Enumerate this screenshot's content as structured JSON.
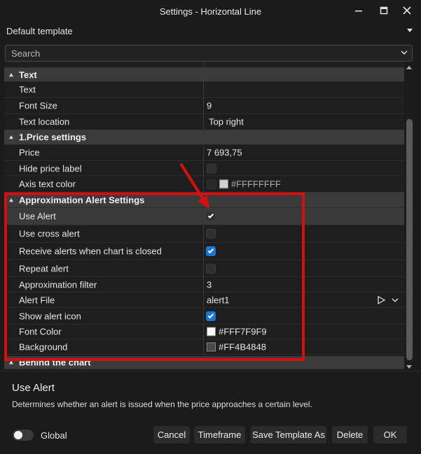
{
  "window": {
    "title": "Settings - Horizontal Line",
    "minimize_icon": "minimize-icon",
    "maximize_icon": "maximize-icon",
    "close_icon": "close-icon"
  },
  "template": {
    "selected": "Default template"
  },
  "search": {
    "placeholder": "Search"
  },
  "sections": {
    "text": {
      "label": "Text",
      "rows": [
        {
          "name": "Text",
          "value": ""
        },
        {
          "name": "Font Size",
          "value": "9"
        },
        {
          "name": "Text location",
          "value": "Top right"
        }
      ]
    },
    "price": {
      "label": "1.Price settings",
      "price": {
        "name": "Price",
        "value": "7 693,75"
      },
      "hide_label": {
        "name": "Hide price label",
        "checked": false
      },
      "axis_color": {
        "name": "Axis text color",
        "value": "#FFFFFFFF",
        "color": "#d0d0d0"
      }
    },
    "alert": {
      "label": "Approximation Alert Settings",
      "use_alert": {
        "name": "Use Alert",
        "checked": true
      },
      "use_cross": {
        "name": "Use cross alert",
        "checked": false
      },
      "receive_closed": {
        "name": "Receive alerts when chart is closed",
        "checked": true
      },
      "repeat": {
        "name": "Repeat alert",
        "checked": false
      },
      "filter": {
        "name": "Approximation filter",
        "value": "3"
      },
      "file": {
        "name": "Alert File",
        "value": "alert1"
      },
      "show_icon": {
        "name": "Show alert icon",
        "checked": true
      },
      "font_color": {
        "name": "Font Color",
        "value": "#FFF7F9F9",
        "color": "#f7f9f9"
      },
      "background": {
        "name": "Background",
        "value": "#FF4B4848",
        "color": "#4b4848"
      }
    },
    "behind": {
      "label": "Behind the chart"
    }
  },
  "description": {
    "title": "Use Alert",
    "text": "Determines whether an alert is issued when the price approaches a certain level."
  },
  "footer": {
    "global_label": "Global",
    "global_on": false,
    "cancel": "Cancel",
    "timeframe": "Timeframe",
    "save_template_as": "Save Template As",
    "delete": "Delete",
    "ok": "OK"
  },
  "colors": {
    "accent": "#1976d2",
    "annotation": "#d40f0f",
    "background": "#1b1b1b"
  }
}
